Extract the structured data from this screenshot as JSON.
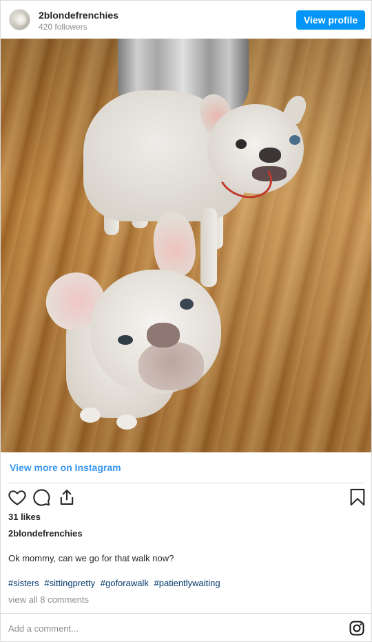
{
  "header": {
    "username": "2blondefrenchies",
    "followers": "420 followers",
    "view_profile_label": "View profile"
  },
  "post": {
    "view_more_label": "View more on Instagram",
    "likes": "31 likes",
    "caption_user": "2blondefrenchies",
    "caption": "Ok mommy, can we go for that walk now?",
    "hashtags": [
      "#sisters",
      "#sittingpretty",
      "#goforawalk",
      "#patientlywaiting"
    ],
    "view_comments": "view all 8 comments"
  },
  "comment_box": {
    "placeholder": "Add a comment..."
  },
  "colors": {
    "accent": "#0095f6",
    "link": "#3897f0",
    "hashtag": "#00376b",
    "muted": "#8e8e8e"
  },
  "icons": [
    "heart-icon",
    "comment-icon",
    "share-icon",
    "bookmark-icon",
    "instagram-icon"
  ]
}
